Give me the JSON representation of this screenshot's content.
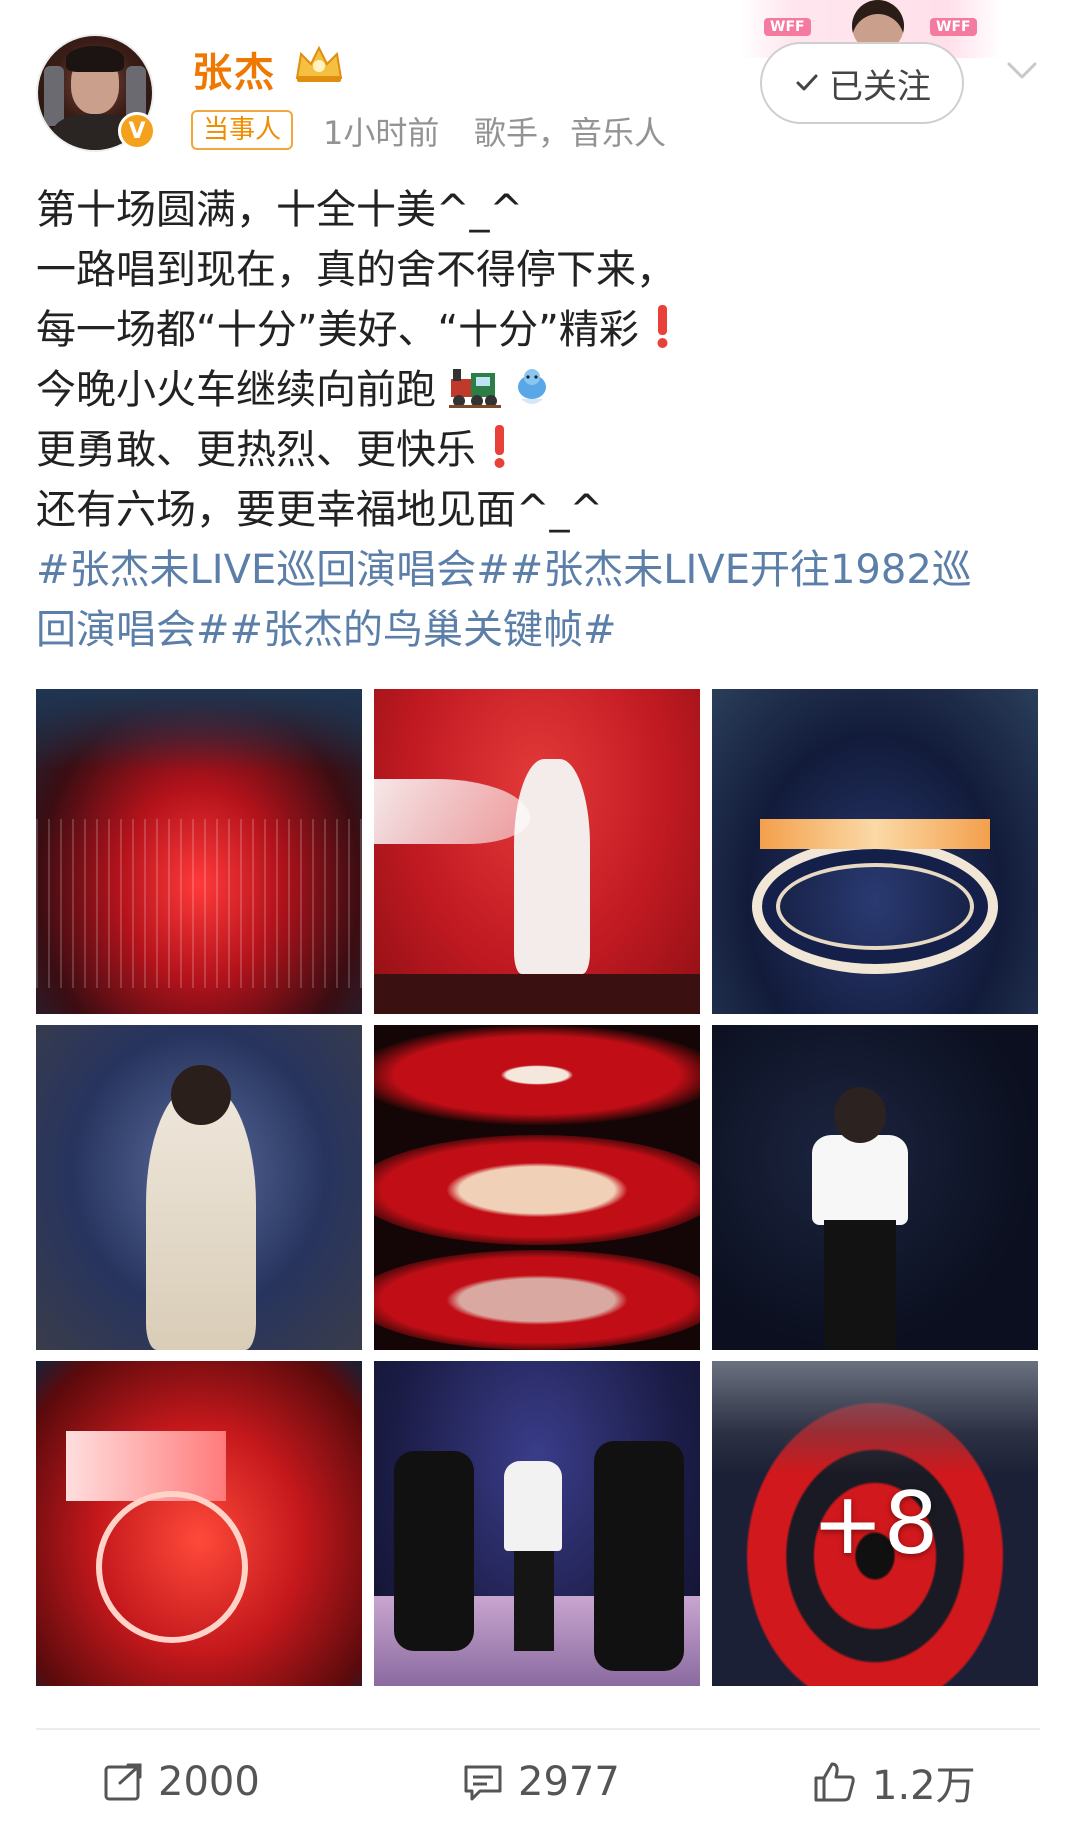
{
  "author": {
    "name": "张杰",
    "verified_mark": "V",
    "tag": "当事人",
    "time": "1小时前",
    "role": "歌手，音乐人"
  },
  "follow_button": {
    "label": "已关注"
  },
  "decoration": {
    "tag_left": "WFF",
    "tag_right": "WFF"
  },
  "post": {
    "lines": [
      "第十场圆满，十全十美^_^",
      "一路唱到现在，真的舍不得停下来，",
      "每一场都“十分”美好、“十分”精彩",
      "今晚小火车继续向前跑",
      "更勇敢、更热烈、更快乐",
      "还有六场，要更幸福地见面^_^"
    ],
    "hashtag_lines": [
      "#张杰未LIVE巡回演唱会##张杰未LIVE开往1982巡",
      "回演唱会##张杰的鸟巢关键帧#"
    ]
  },
  "images": {
    "more_count": "+8",
    "tiles": [
      {
        "name": "stadium-red-light-tile"
      },
      {
        "name": "white-robe-performer-tile"
      },
      {
        "name": "stadium-ring-stage-tile"
      },
      {
        "name": "singer-white-costume-tile"
      },
      {
        "name": "red-circle-dancers-tile"
      },
      {
        "name": "singer-white-shirt-tile"
      },
      {
        "name": "red-stage-logo-tile"
      },
      {
        "name": "group-performers-tile"
      },
      {
        "name": "stadium-target-stage-tile"
      }
    ]
  },
  "actions": {
    "repost": "2000",
    "comment": "2977",
    "like": "1.2万"
  },
  "colors": {
    "username": "#ef7800",
    "hashtag": "#5b7fa8",
    "meta": "#939393"
  }
}
